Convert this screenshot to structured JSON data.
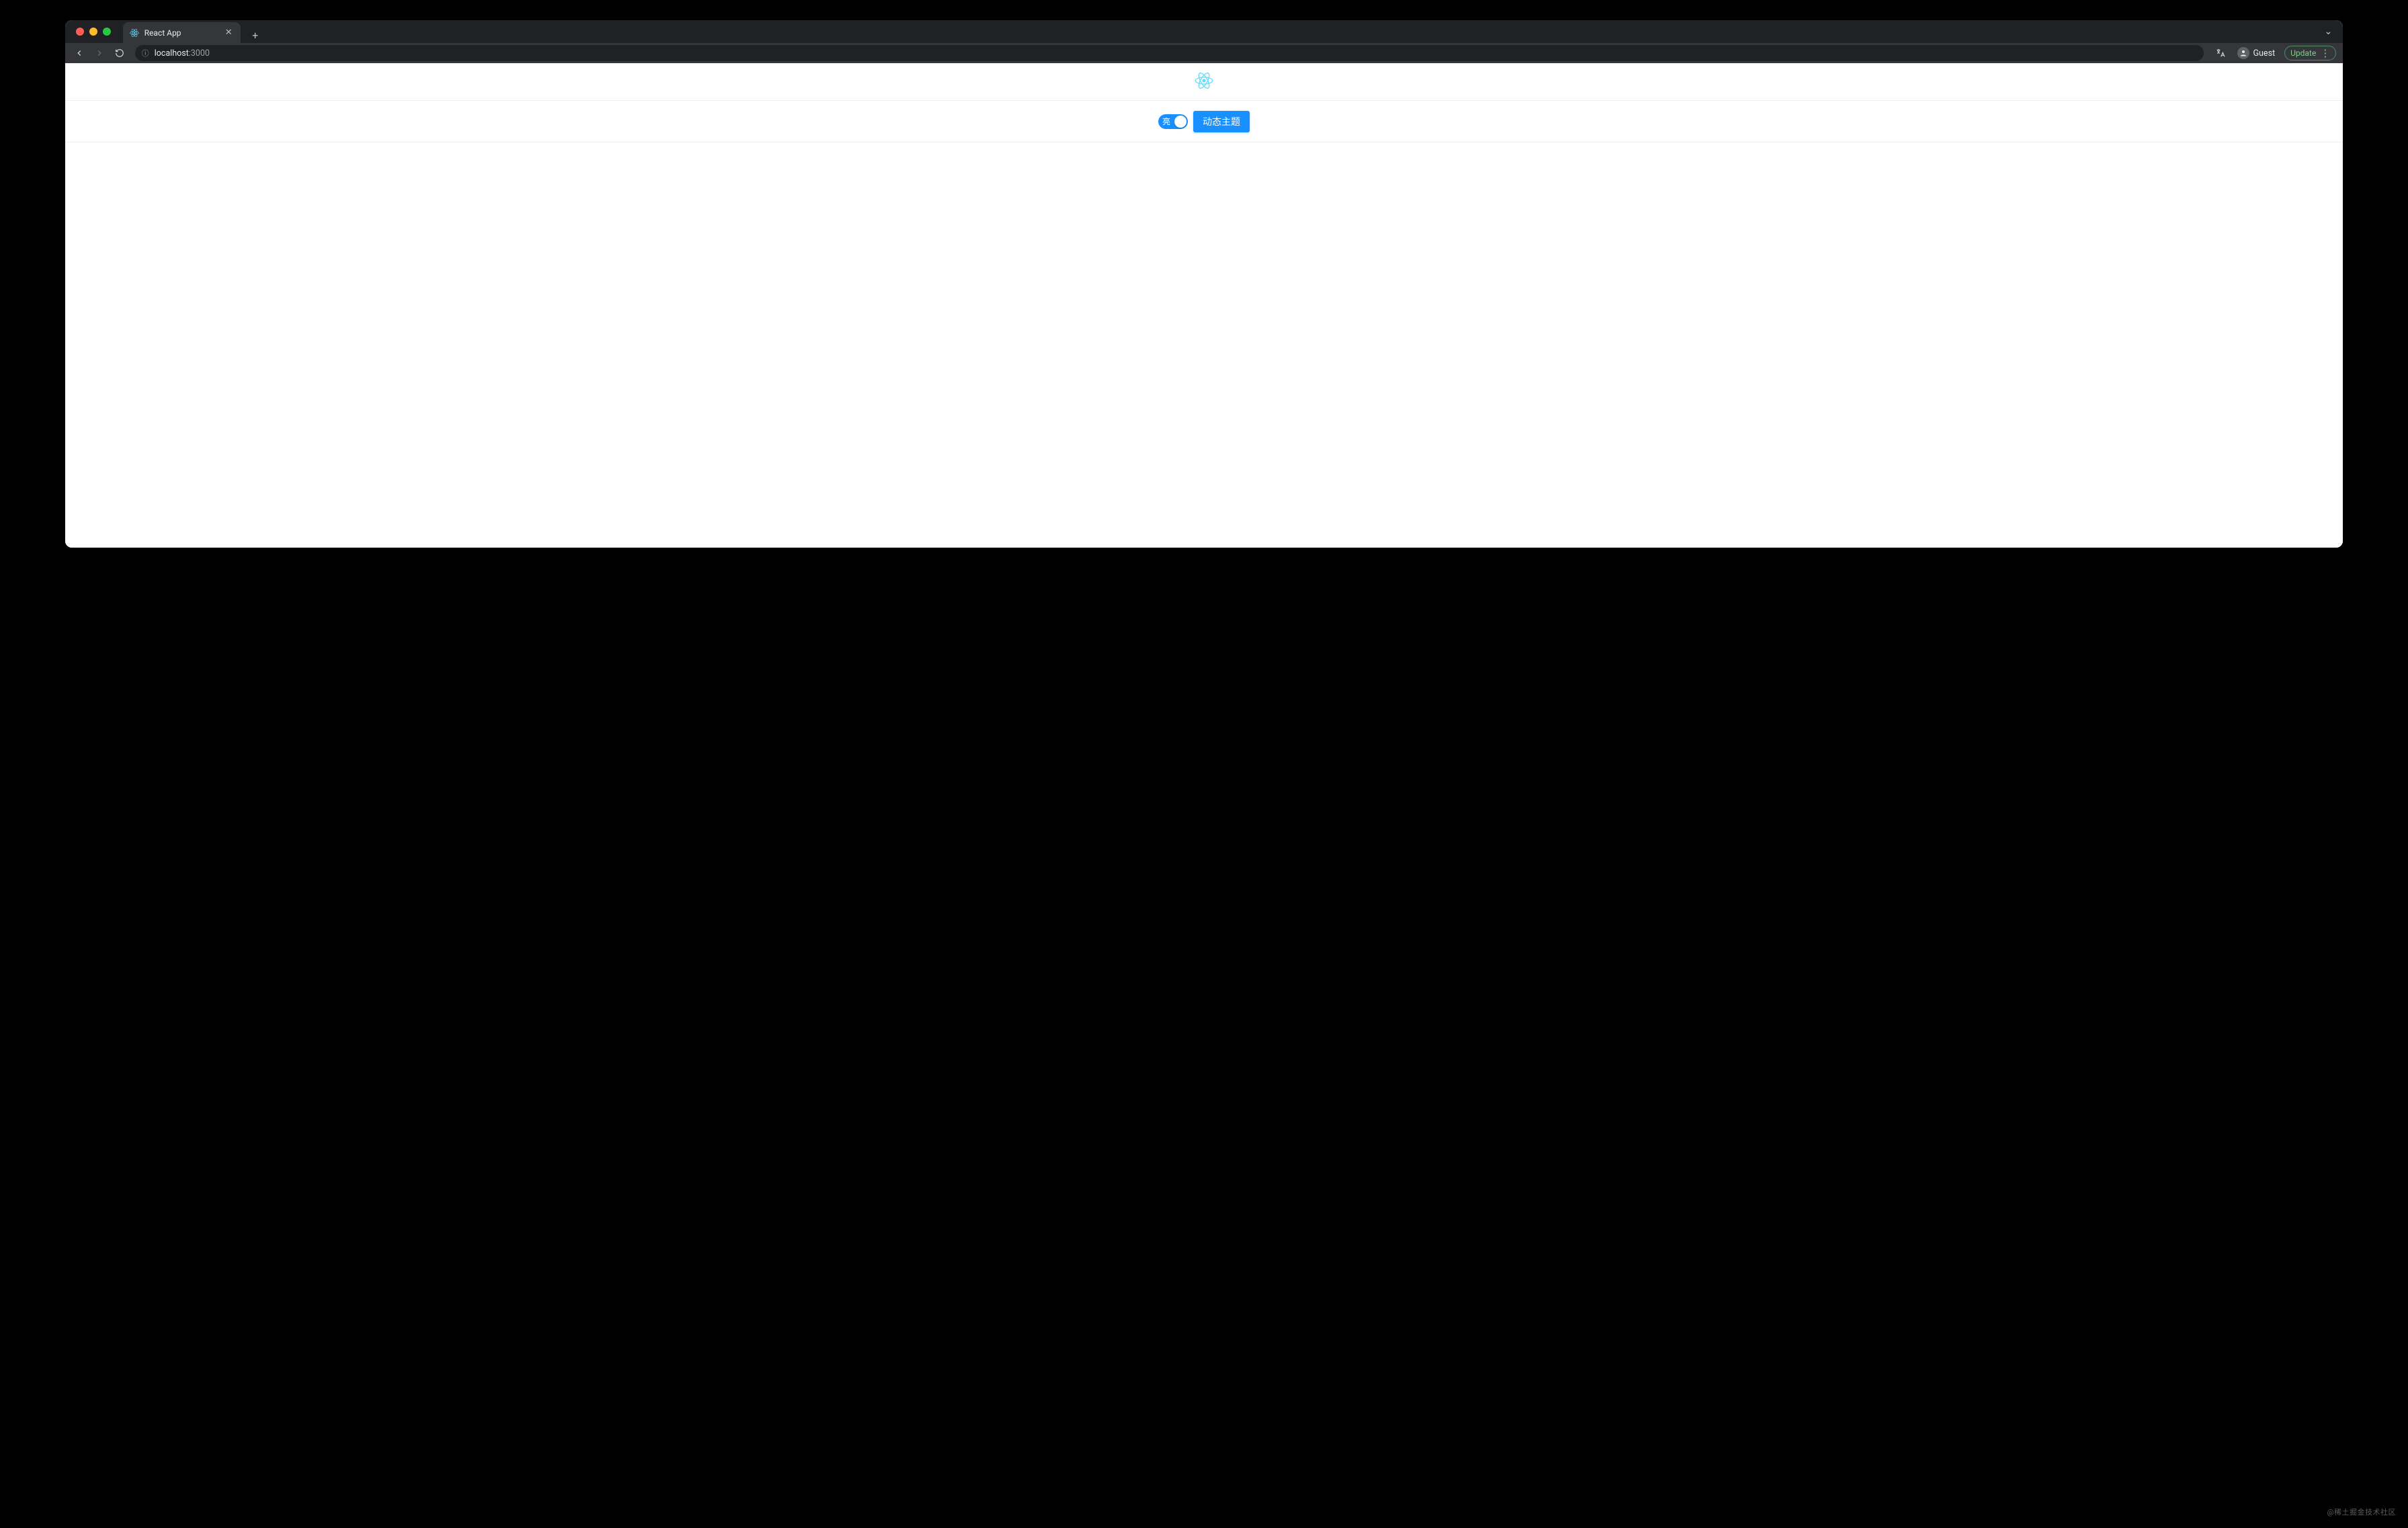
{
  "browser": {
    "tab": {
      "title": "React App",
      "favicon": "react-icon"
    },
    "nav": {
      "back_enabled": true,
      "forward_enabled": false
    },
    "address": {
      "host": "localhost",
      "port": ":3000"
    },
    "profile": "Guest",
    "update_label": "Update"
  },
  "page": {
    "logo": "react-logo",
    "switch": {
      "label": "亮",
      "checked": true
    },
    "theme_button_label": "动态主题"
  },
  "watermark": "@稀土掘金技术社区",
  "colors": {
    "primary": "#1890ff",
    "react": "#61dafb"
  }
}
